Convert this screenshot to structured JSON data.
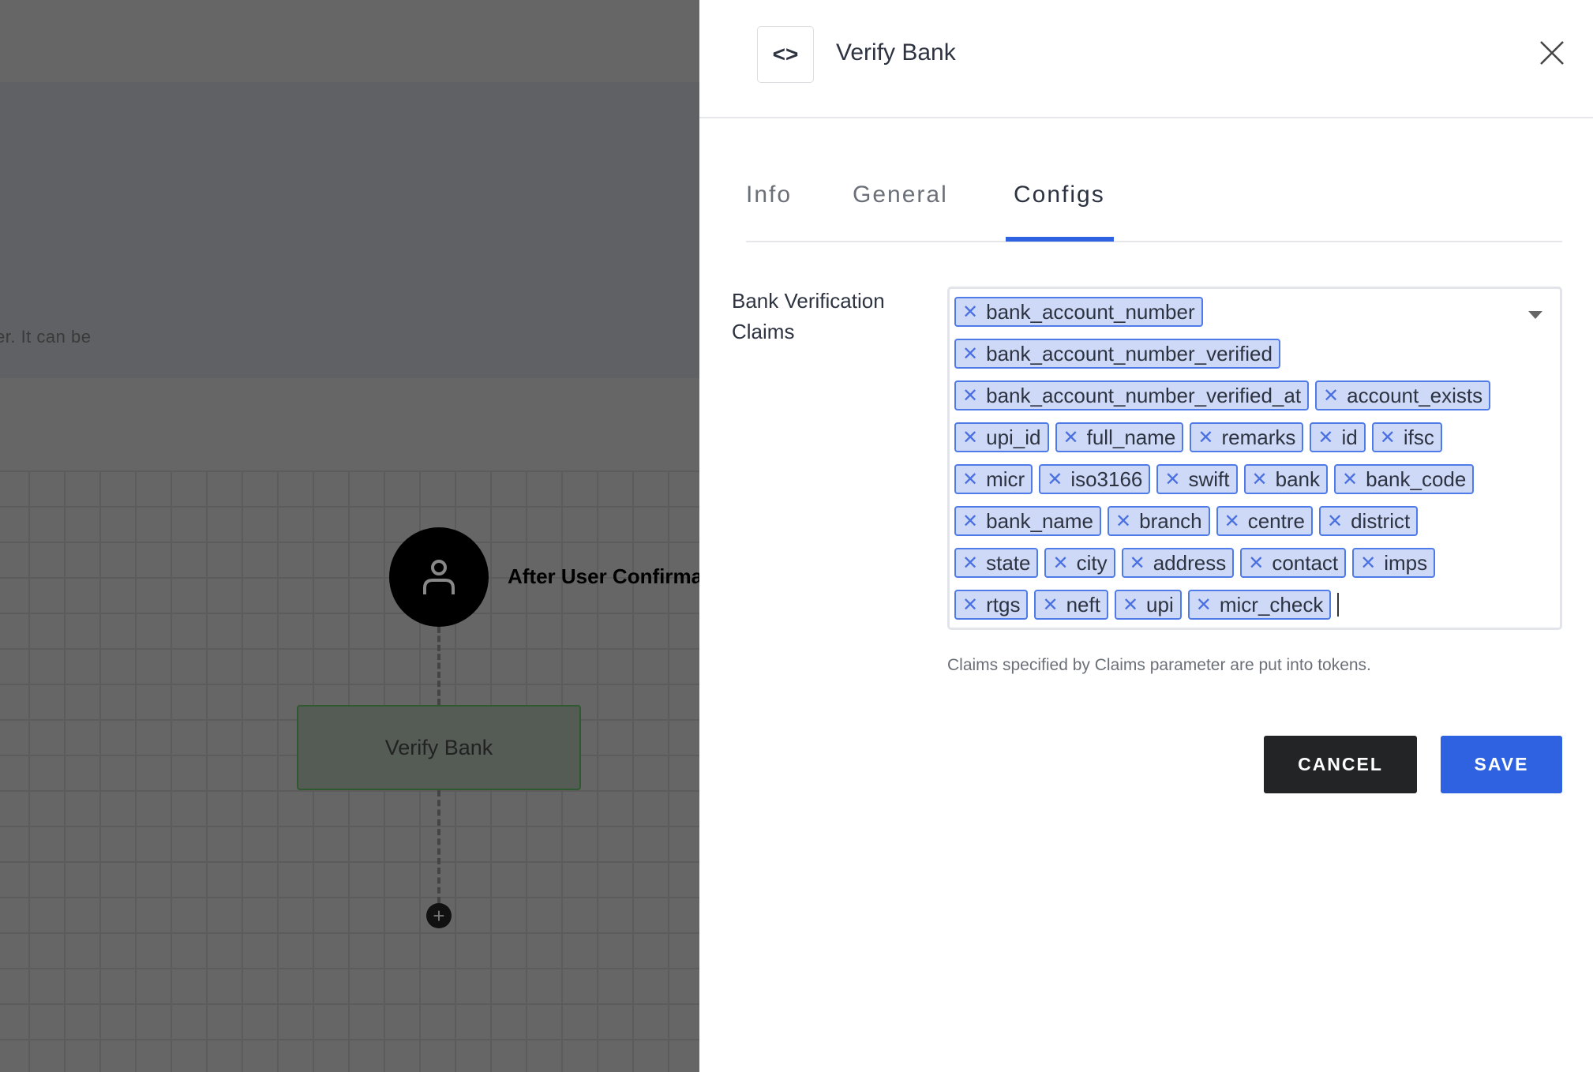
{
  "background": {
    "partial_text": "er. It can be",
    "node_label": "After User Confirmat",
    "step_label": "Verify Bank",
    "add_step_icon": "plus-icon"
  },
  "panel": {
    "title": "Verify Bank",
    "title_icon": "code-icon",
    "close_icon": "close-icon",
    "tabs": [
      {
        "label": "Info",
        "active": false
      },
      {
        "label": "General",
        "active": false
      },
      {
        "label": "Configs",
        "active": true
      }
    ],
    "field": {
      "label": "Bank Verification Claims",
      "chips": [
        "bank_account_number",
        "bank_account_number_verified",
        "bank_account_number_verified_at",
        "account_exists",
        "upi_id",
        "full_name",
        "remarks",
        "id",
        "ifsc",
        "micr",
        "iso3166",
        "swift",
        "bank",
        "bank_code",
        "bank_name",
        "branch",
        "centre",
        "district",
        "state",
        "city",
        "address",
        "contact",
        "imps",
        "rtgs",
        "neft",
        "upi",
        "micr_check"
      ],
      "help": "Claims specified by Claims parameter are put into tokens."
    },
    "cancel_label": "CANCEL",
    "save_label": "SAVE",
    "accent": "#2f62e0"
  }
}
